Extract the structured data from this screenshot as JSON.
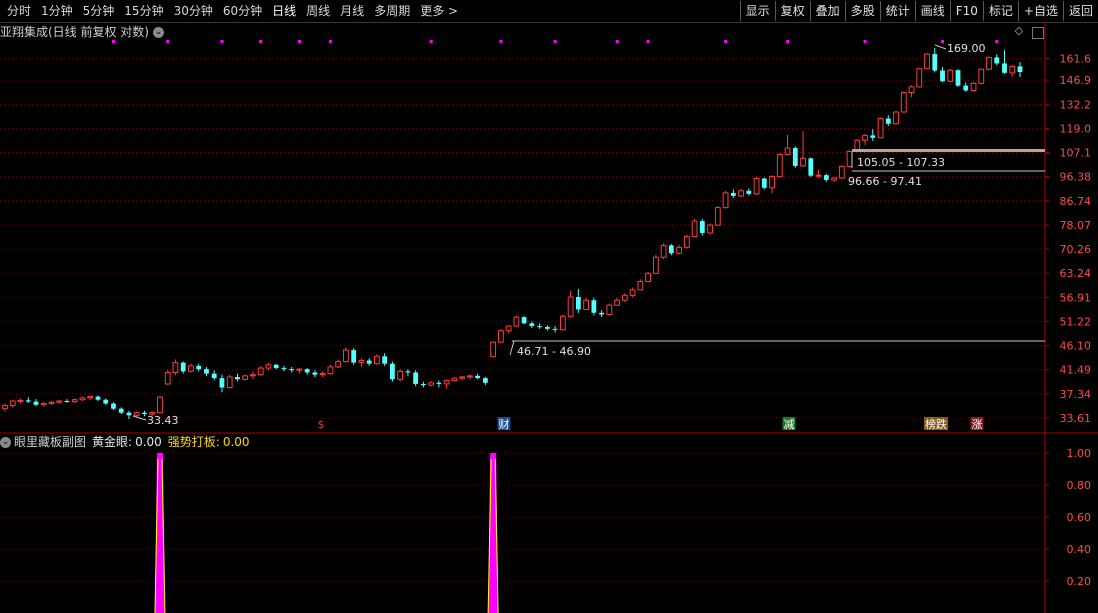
{
  "toolbar": {
    "left_items": [
      {
        "label": "分时",
        "name": "tab-intraday"
      },
      {
        "label": "1分钟",
        "name": "tab-1min"
      },
      {
        "label": "5分钟",
        "name": "tab-5min"
      },
      {
        "label": "15分钟",
        "name": "tab-15min"
      },
      {
        "label": "30分钟",
        "name": "tab-30min"
      },
      {
        "label": "60分钟",
        "name": "tab-60min"
      },
      {
        "label": "日线",
        "name": "tab-daily",
        "active": true
      },
      {
        "label": "周线",
        "name": "tab-weekly"
      },
      {
        "label": "月线",
        "name": "tab-monthly"
      },
      {
        "label": "多周期",
        "name": "tab-multi-period"
      },
      {
        "label": "更多 >",
        "name": "tab-more"
      }
    ],
    "right_buttons": [
      {
        "label": "显示",
        "name": "display-button"
      },
      {
        "label": "复权",
        "name": "adjust-button"
      },
      {
        "label": "叠加",
        "name": "overlay-button"
      },
      {
        "label": "多股",
        "name": "multi-stock-button"
      },
      {
        "label": "统计",
        "name": "statistics-button"
      },
      {
        "label": "画线",
        "name": "draw-line-button"
      },
      {
        "label": "F10",
        "name": "f10-button"
      },
      {
        "label": "标记",
        "name": "mark-button"
      },
      {
        "label": "+自选",
        "name": "add-watchlist-button"
      },
      {
        "label": "返回",
        "name": "back-button"
      }
    ]
  },
  "main_panel": {
    "title": "亚翔集成(日线 前复权 对数)",
    "toggle_icon": "chevron-down-icon",
    "y_ticks": [
      "161.6",
      "146.9",
      "132.2",
      "119.0",
      "107.1",
      "96.38",
      "86.74",
      "78.07",
      "70.26",
      "63.24",
      "56.91",
      "51.22",
      "46.10",
      "41.49",
      "37.34",
      "33.61"
    ],
    "annotations": {
      "high": "169.00",
      "low": "33.43",
      "range_1": "46.71 - 46.90",
      "range_2": "105.05 - 107.33",
      "range_3": "96.66 - 97.41"
    },
    "event_markers": [
      {
        "label": "$",
        "color": "#ff3030"
      },
      {
        "label": "财",
        "color": "#ffffff",
        "bg": "#1e4d8c"
      },
      {
        "label": "减",
        "color": "#ffffff",
        "bg": "#1f7a2a"
      },
      {
        "label": "榜跌",
        "color": "#ffffff",
        "bg": "#8a5a1a"
      },
      {
        "label": "涨",
        "color": "#ffffff",
        "bg": "#8a1a1a"
      }
    ]
  },
  "sub_panel": {
    "name": "眼里藏板副图",
    "gold_eye_label": "黄金眼:",
    "gold_eye_value": "0.00",
    "strong_board_label": "强势打板:",
    "strong_board_value": "0.00",
    "y_ticks": [
      "1.00",
      "0.80",
      "0.60",
      "0.40",
      "0.20"
    ],
    "toggle_icon": "chevron-down-icon"
  },
  "colors": {
    "up": "#ff3b3b",
    "down": "#54ffff",
    "grid": "#7a0000",
    "axis": "#b00000",
    "signal": "#ff00ff",
    "dots": "#ff00ff"
  },
  "chart_data": {
    "type": "candlestick",
    "scale": "log",
    "ylim": [
      33.61,
      169.0
    ],
    "candles": [
      [
        35.0,
        35.8,
        34.6,
        35.5
      ],
      [
        35.5,
        36.4,
        35.2,
        36.2
      ],
      [
        36.2,
        36.6,
        35.8,
        36.3
      ],
      [
        36.3,
        36.8,
        35.9,
        36.1
      ],
      [
        36.1,
        36.5,
        35.4,
        35.6
      ],
      [
        35.6,
        36.0,
        35.3,
        35.8
      ],
      [
        35.8,
        36.2,
        35.6,
        36.0
      ],
      [
        36.0,
        36.4,
        35.8,
        36.2
      ],
      [
        36.2,
        36.5,
        35.9,
        36.1
      ],
      [
        36.1,
        36.6,
        35.9,
        36.4
      ],
      [
        36.4,
        36.9,
        36.2,
        36.7
      ],
      [
        36.7,
        37.0,
        36.4,
        36.9
      ],
      [
        36.9,
        37.1,
        36.2,
        36.4
      ],
      [
        36.4,
        36.6,
        35.6,
        35.8
      ],
      [
        35.8,
        36.0,
        34.8,
        35.0
      ],
      [
        35.0,
        35.2,
        34.2,
        34.4
      ],
      [
        34.4,
        34.7,
        33.43,
        34.0
      ],
      [
        34.0,
        34.6,
        33.8,
        34.4
      ],
      [
        34.4,
        34.7,
        33.9,
        34.2
      ],
      [
        34.2,
        34.6,
        33.9,
        34.4
      ],
      [
        34.4,
        37.0,
        34.3,
        36.8
      ],
      [
        39.0,
        41.5,
        38.8,
        41.0
      ],
      [
        41.0,
        43.4,
        40.5,
        42.8
      ],
      [
        42.8,
        43.0,
        40.8,
        41.2
      ],
      [
        41.2,
        42.6,
        41.0,
        42.2
      ],
      [
        42.2,
        42.6,
        41.2,
        41.6
      ],
      [
        41.6,
        42.0,
        40.4,
        40.8
      ],
      [
        40.8,
        41.4,
        39.6,
        40.0
      ],
      [
        40.0,
        40.6,
        37.6,
        38.4
      ],
      [
        38.4,
        40.6,
        38.2,
        40.2
      ],
      [
        40.2,
        40.8,
        39.4,
        39.8
      ],
      [
        39.8,
        40.6,
        39.6,
        40.4
      ],
      [
        40.4,
        41.2,
        39.8,
        40.6
      ],
      [
        40.6,
        42.2,
        40.4,
        41.8
      ],
      [
        41.8,
        42.8,
        41.4,
        42.4
      ],
      [
        42.4,
        42.6,
        41.6,
        41.8
      ],
      [
        41.8,
        42.2,
        41.2,
        41.6
      ],
      [
        41.6,
        42.0,
        41.0,
        41.4
      ],
      [
        41.4,
        41.8,
        40.8,
        41.6
      ],
      [
        41.6,
        41.8,
        40.6,
        41.0
      ],
      [
        41.0,
        41.4,
        40.2,
        40.6
      ],
      [
        40.6,
        41.2,
        40.2,
        40.8
      ],
      [
        40.8,
        42.4,
        40.6,
        42.0
      ],
      [
        42.0,
        43.4,
        41.8,
        43.0
      ],
      [
        43.0,
        45.8,
        42.8,
        45.2
      ],
      [
        45.2,
        45.6,
        42.4,
        42.8
      ],
      [
        42.8,
        43.6,
        42.0,
        43.2
      ],
      [
        43.2,
        43.6,
        42.2,
        42.6
      ],
      [
        42.6,
        44.4,
        42.4,
        44.0
      ],
      [
        44.0,
        44.6,
        42.2,
        42.6
      ],
      [
        42.6,
        43.0,
        39.4,
        39.8
      ],
      [
        39.8,
        41.6,
        39.4,
        41.2
      ],
      [
        41.2,
        41.6,
        40.4,
        41.0
      ],
      [
        41.0,
        41.4,
        38.6,
        39.0
      ],
      [
        39.0,
        39.4,
        38.4,
        38.8
      ],
      [
        38.8,
        39.4,
        38.6,
        39.2
      ],
      [
        39.2,
        39.6,
        38.4,
        39.0
      ],
      [
        39.0,
        39.8,
        38.2,
        39.6
      ],
      [
        39.6,
        40.2,
        39.4,
        40.0
      ],
      [
        40.0,
        40.4,
        39.6,
        40.2
      ],
      [
        40.2,
        40.6,
        39.8,
        40.4
      ],
      [
        40.4,
        40.8,
        39.8,
        40.0
      ],
      [
        40.0,
        40.2,
        38.8,
        39.2
      ],
      [
        44.0,
        46.9,
        44.0,
        46.8
      ],
      [
        46.8,
        49.5,
        46.6,
        49.2
      ],
      [
        49.2,
        50.4,
        48.6,
        50.2
      ],
      [
        50.2,
        52.6,
        50.0,
        52.2
      ],
      [
        52.2,
        52.4,
        50.6,
        50.8
      ],
      [
        50.8,
        51.2,
        49.8,
        50.2
      ],
      [
        50.2,
        50.8,
        49.6,
        50.0
      ],
      [
        50.0,
        50.4,
        49.2,
        49.6
      ],
      [
        49.6,
        50.2,
        48.8,
        49.4
      ],
      [
        49.4,
        52.8,
        49.2,
        52.4
      ],
      [
        52.4,
        58.6,
        52.2,
        57.0
      ],
      [
        57.0,
        59.0,
        53.2,
        54.0
      ],
      [
        54.0,
        56.8,
        53.8,
        56.2
      ],
      [
        56.2,
        56.8,
        52.6,
        53.2
      ],
      [
        53.2,
        53.8,
        52.2,
        52.8
      ],
      [
        52.8,
        55.4,
        52.6,
        55.0
      ],
      [
        55.0,
        56.8,
        54.8,
        56.2
      ],
      [
        56.2,
        58.0,
        55.8,
        57.4
      ],
      [
        57.4,
        59.4,
        57.0,
        58.8
      ],
      [
        58.8,
        61.6,
        58.6,
        61.0
      ],
      [
        61.0,
        63.6,
        60.8,
        63.2
      ],
      [
        63.2,
        68.6,
        63.0,
        67.8
      ],
      [
        67.8,
        72.0,
        67.2,
        71.4
      ],
      [
        71.4,
        71.8,
        68.4,
        69.0
      ],
      [
        69.0,
        71.6,
        68.6,
        70.8
      ],
      [
        70.8,
        74.8,
        70.4,
        74.2
      ],
      [
        74.2,
        80.2,
        74.0,
        79.4
      ],
      [
        79.4,
        80.0,
        74.6,
        75.4
      ],
      [
        75.4,
        78.6,
        74.8,
        78.0
      ],
      [
        78.0,
        84.8,
        77.6,
        84.2
      ],
      [
        84.2,
        90.6,
        83.8,
        89.8
      ],
      [
        89.8,
        91.2,
        87.8,
        88.6
      ],
      [
        88.6,
        91.4,
        88.2,
        90.6
      ],
      [
        90.6,
        91.6,
        88.8,
        89.4
      ],
      [
        89.4,
        96.2,
        89.0,
        95.6
      ],
      [
        95.6,
        96.0,
        91.2,
        91.8
      ],
      [
        91.8,
        97.0,
        89.6,
        96.4
      ],
      [
        96.4,
        106.8,
        96.0,
        106.2
      ],
      [
        106.2,
        115.6,
        105.8,
        109.2
      ],
      [
        109.2,
        110.0,
        100.2,
        101.0
      ],
      [
        101.0,
        117.6,
        100.6,
        104.4
      ],
      [
        104.4,
        104.8,
        96.2,
        96.8
      ],
      [
        96.8,
        99.4,
        95.8,
        97.0
      ],
      [
        97.0,
        97.6,
        94.2,
        95.0
      ],
      [
        95.0,
        96.2,
        94.2,
        95.8
      ],
      [
        95.8,
        101.2,
        95.4,
        100.8
      ],
      [
        100.8,
        108.2,
        100.2,
        107.6
      ],
      [
        107.6,
        113.4,
        107.2,
        113.0
      ],
      [
        113.0,
        116.2,
        110.6,
        115.4
      ],
      [
        115.4,
        118.6,
        112.6,
        114.2
      ],
      [
        114.2,
        124.8,
        114.0,
        124.2
      ],
      [
        124.2,
        126.0,
        120.2,
        121.4
      ],
      [
        121.4,
        128.4,
        121.0,
        127.8
      ],
      [
        127.8,
        139.6,
        127.4,
        139.2
      ],
      [
        139.2,
        143.6,
        136.4,
        142.6
      ],
      [
        142.6,
        155.0,
        142.2,
        154.4
      ],
      [
        154.4,
        165.2,
        154.0,
        164.6
      ],
      [
        164.6,
        169.0,
        152.0,
        153.2
      ],
      [
        153.2,
        155.6,
        145.6,
        146.2
      ],
      [
        146.2,
        154.2,
        145.6,
        153.4
      ],
      [
        153.4,
        154.0,
        142.6,
        143.4
      ],
      [
        143.4,
        145.4,
        139.6,
        140.4
      ],
      [
        140.4,
        145.6,
        139.8,
        144.8
      ],
      [
        144.8,
        154.6,
        144.2,
        154.0
      ],
      [
        154.0,
        162.8,
        153.6,
        162.2
      ],
      [
        162.2,
        164.4,
        156.8,
        158.0
      ],
      [
        158.0,
        167.4,
        150.8,
        151.6
      ],
      [
        151.6,
        156.8,
        149.2,
        156.0
      ],
      [
        156.0,
        159.0,
        148.8,
        152.2
      ]
    ],
    "pink_dots_at": [
      14,
      21,
      28,
      33,
      38,
      42,
      55,
      64,
      71,
      79,
      83,
      93,
      101,
      111,
      121,
      128
    ],
    "signal_bars": {
      "positions": [
        20,
        63
      ],
      "value": 1.0
    }
  }
}
